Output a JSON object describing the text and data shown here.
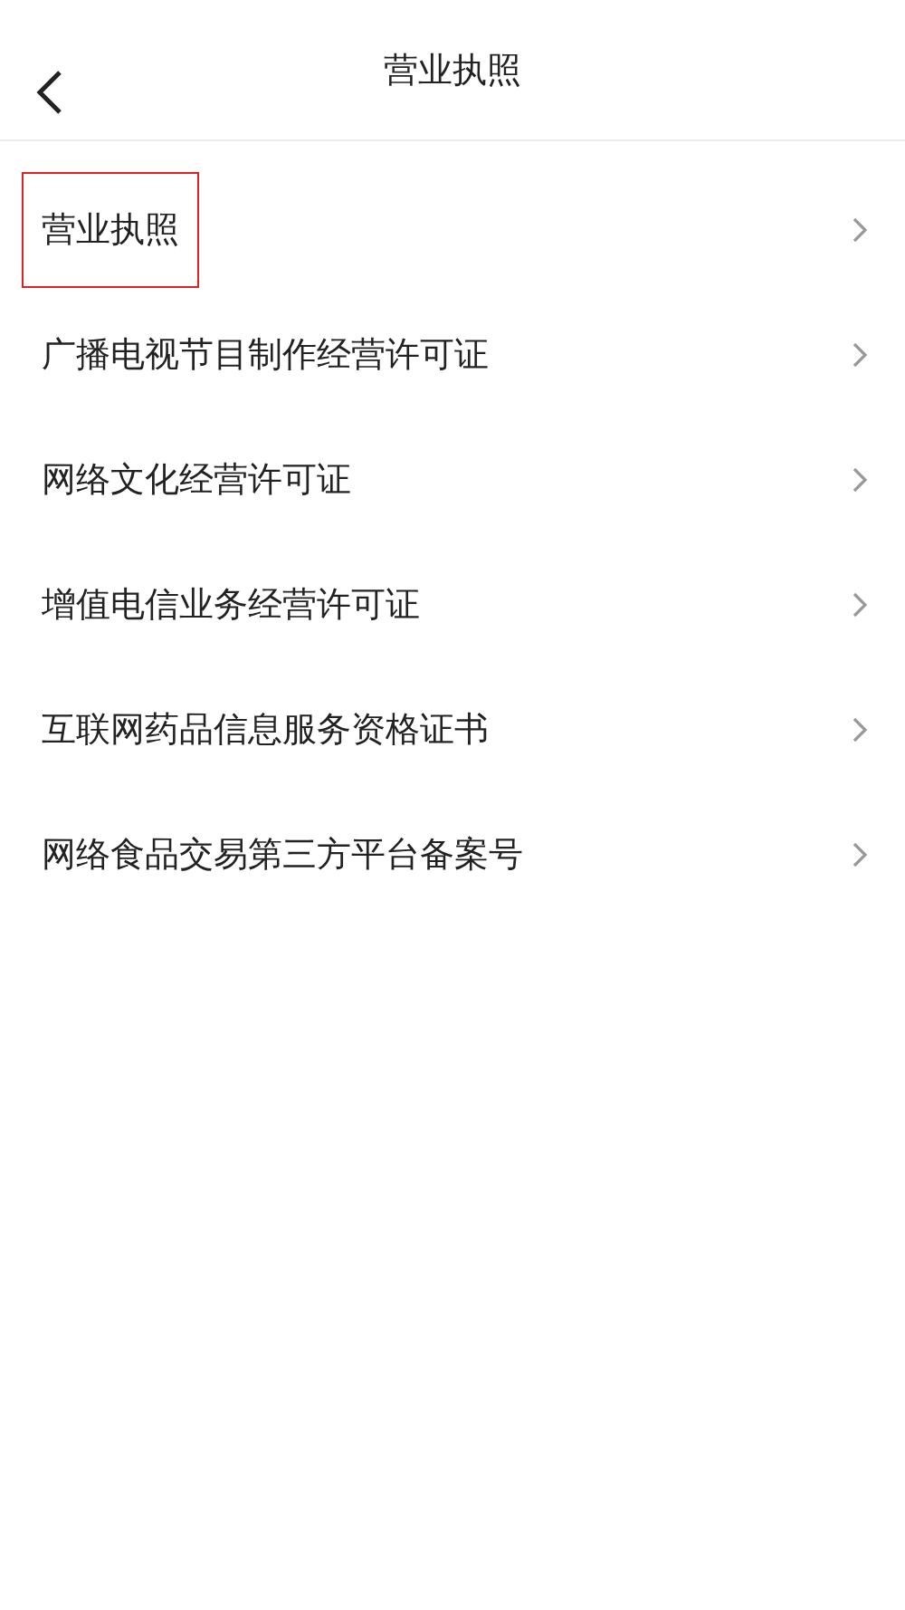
{
  "header": {
    "title": "营业执照"
  },
  "items": [
    {
      "label": "营业执照",
      "highlighted": true
    },
    {
      "label": "广播电视节目制作经营许可证",
      "highlighted": false
    },
    {
      "label": "网络文化经营许可证",
      "highlighted": false
    },
    {
      "label": "增值电信业务经营许可证",
      "highlighted": false
    },
    {
      "label": "互联网药品信息服务资格证书",
      "highlighted": false
    },
    {
      "label": "网络食品交易第三方平台备案号",
      "highlighted": false
    }
  ]
}
